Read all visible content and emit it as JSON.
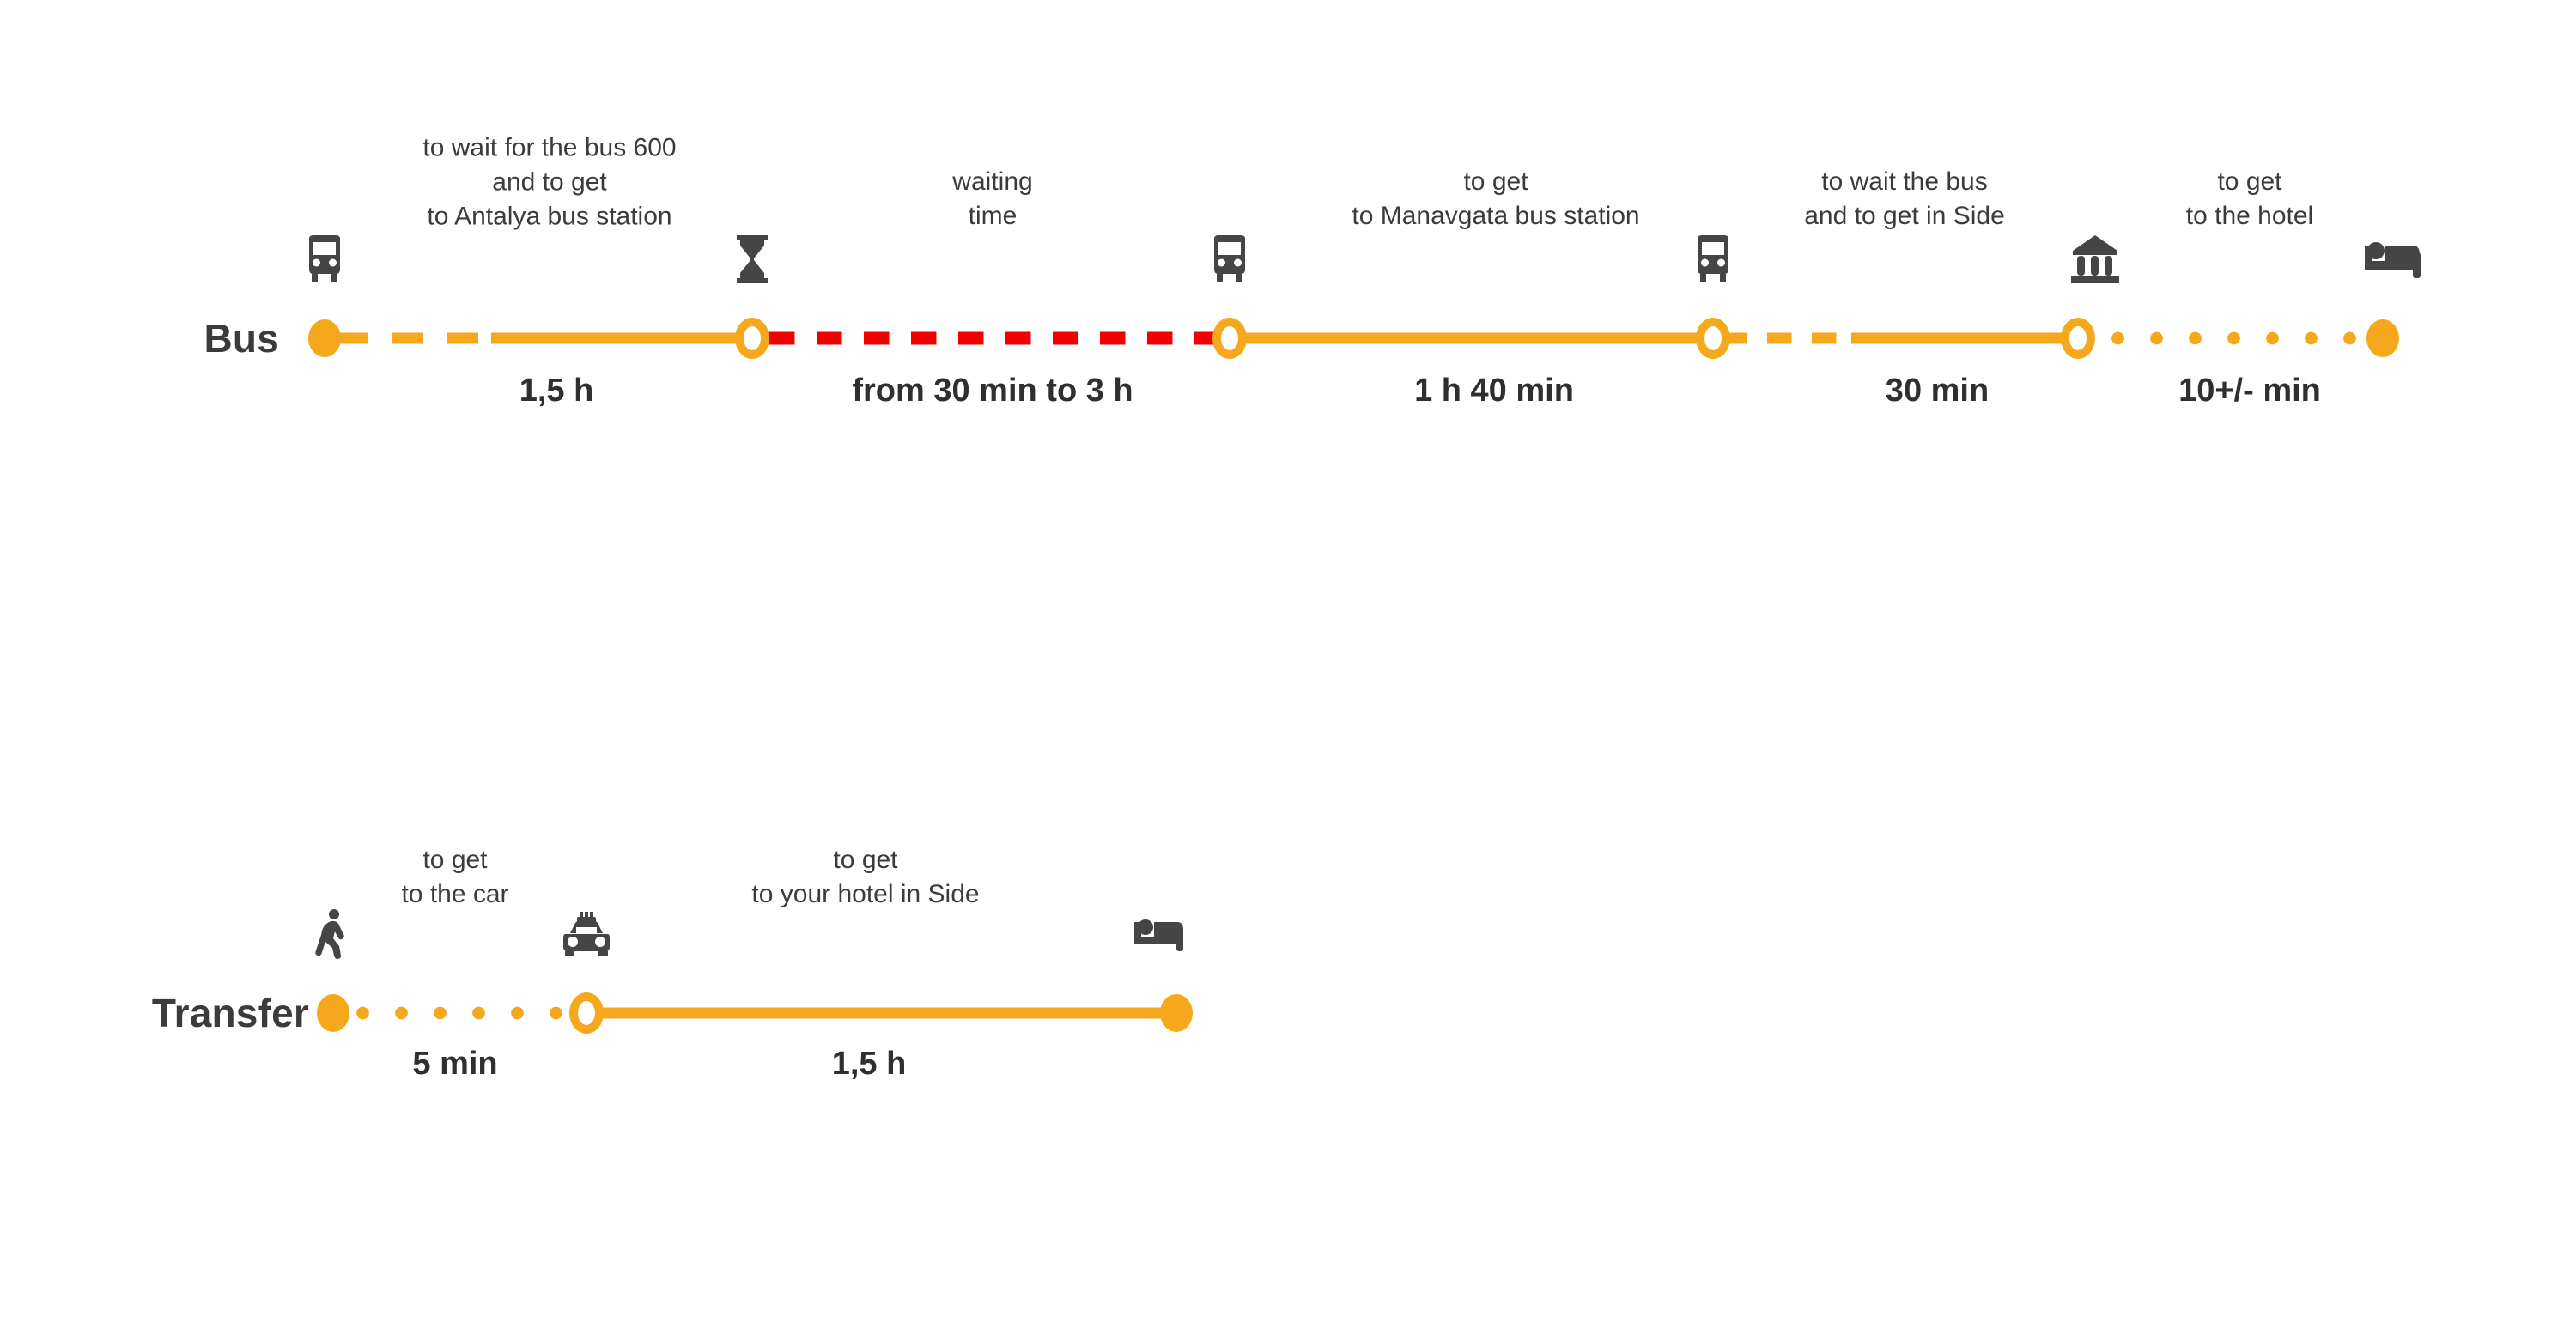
{
  "palette": {
    "orange": "#F5A81C",
    "red": "#F20000",
    "icon_gray": "#454545",
    "text_dark": "#3B3B3B",
    "background": "#FFFFFF"
  },
  "routes": [
    {
      "id": "bus",
      "title": "Bus",
      "nodes": [
        {
          "name": "origin",
          "type": "filled"
        },
        {
          "name": "antalya-bus-station",
          "type": "ring"
        },
        {
          "name": "bus-departure",
          "type": "ring"
        },
        {
          "name": "manavgata-bus-station",
          "type": "ring"
        },
        {
          "name": "side-arrival",
          "type": "ring"
        },
        {
          "name": "hotel",
          "type": "filled"
        }
      ],
      "segments": [
        {
          "name": "to-antalya-bus-station",
          "icon": "bus-icon",
          "caption": "to wait for the bus  600\nand to get\nto Antalya bus station",
          "duration": "1,5 h",
          "style": "dash-then-solid",
          "color": "orange"
        },
        {
          "name": "waiting-time",
          "icon": "hourglass-icon",
          "caption": "waiting\ntime",
          "duration": "from 30 min to 3 h",
          "style": "dashed",
          "color": "red"
        },
        {
          "name": "to-manavgata-bus-station",
          "icon": "bus-icon",
          "caption": "to get\nto Manavgata bus station",
          "duration": "1 h 40 min",
          "style": "solid",
          "color": "orange"
        },
        {
          "name": "to-side",
          "icon": "bus-icon",
          "caption": "to wait the bus\nand to get in Side",
          "duration": "30 min",
          "style": "dash-then-solid",
          "color": "orange"
        },
        {
          "name": "to-the-hotel",
          "icon": "temple-icon",
          "caption": "to get\nto the hotel",
          "duration": "10+/- min",
          "style": "dotted",
          "color": "orange"
        }
      ],
      "end_icon": "bed-icon"
    },
    {
      "id": "transfer",
      "title": "Transfer",
      "nodes": [
        {
          "name": "origin",
          "type": "filled"
        },
        {
          "name": "car-pickup",
          "type": "ring"
        },
        {
          "name": "hotel",
          "type": "filled"
        }
      ],
      "segments": [
        {
          "name": "to-the-car",
          "icon": "walking-icon",
          "caption": "to get\nto the car",
          "duration": "5 min",
          "style": "dotted",
          "color": "orange"
        },
        {
          "name": "to-your-hotel-in-side",
          "icon": "taxi-icon",
          "caption": "to get\nto your hotel in Side",
          "duration": "1,5 h",
          "style": "solid",
          "color": "orange"
        }
      ],
      "end_icon": "bed-icon"
    }
  ]
}
